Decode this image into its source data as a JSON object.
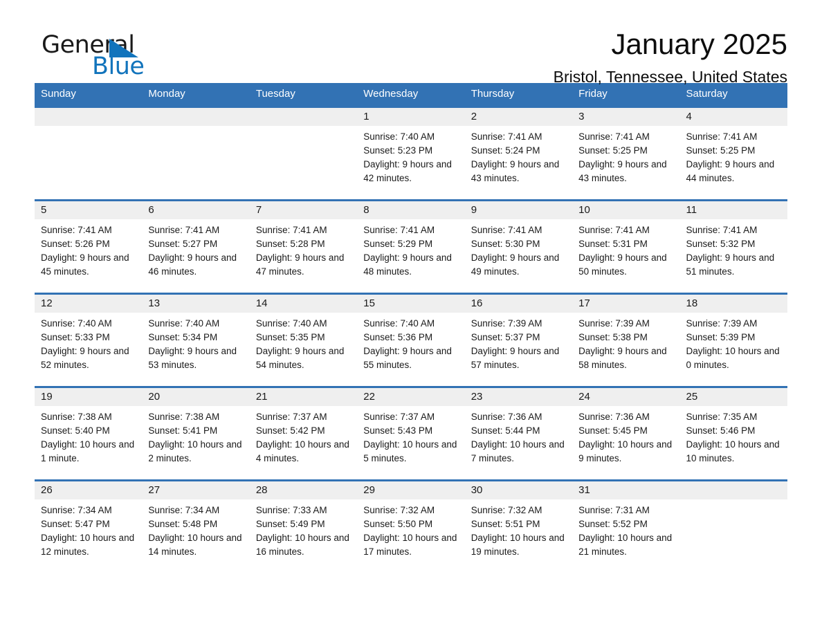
{
  "logo": {
    "word_one": "General",
    "word_two": "Blue",
    "triangle_icon": "triangle-icon",
    "accent_color": "#1274bc"
  },
  "header": {
    "month_title": "January 2025",
    "location": "Bristol, Tennessee, United States"
  },
  "calendar": {
    "header_color": "#3272b4",
    "daynum_band_color": "#efefef",
    "weekday_headers": [
      "Sunday",
      "Monday",
      "Tuesday",
      "Wednesday",
      "Thursday",
      "Friday",
      "Saturday"
    ],
    "weeks": [
      [
        {
          "day": "",
          "sunrise": "",
          "sunset": "",
          "daylight": "",
          "empty": true
        },
        {
          "day": "",
          "sunrise": "",
          "sunset": "",
          "daylight": "",
          "empty": true
        },
        {
          "day": "",
          "sunrise": "",
          "sunset": "",
          "daylight": "",
          "empty": true
        },
        {
          "day": "1",
          "sunrise": "Sunrise: 7:40 AM",
          "sunset": "Sunset: 5:23 PM",
          "daylight": "Daylight: 9 hours and 42 minutes.",
          "empty": false
        },
        {
          "day": "2",
          "sunrise": "Sunrise: 7:41 AM",
          "sunset": "Sunset: 5:24 PM",
          "daylight": "Daylight: 9 hours and 43 minutes.",
          "empty": false
        },
        {
          "day": "3",
          "sunrise": "Sunrise: 7:41 AM",
          "sunset": "Sunset: 5:25 PM",
          "daylight": "Daylight: 9 hours and 43 minutes.",
          "empty": false
        },
        {
          "day": "4",
          "sunrise": "Sunrise: 7:41 AM",
          "sunset": "Sunset: 5:25 PM",
          "daylight": "Daylight: 9 hours and 44 minutes.",
          "empty": false
        }
      ],
      [
        {
          "day": "5",
          "sunrise": "Sunrise: 7:41 AM",
          "sunset": "Sunset: 5:26 PM",
          "daylight": "Daylight: 9 hours and 45 minutes.",
          "empty": false
        },
        {
          "day": "6",
          "sunrise": "Sunrise: 7:41 AM",
          "sunset": "Sunset: 5:27 PM",
          "daylight": "Daylight: 9 hours and 46 minutes.",
          "empty": false
        },
        {
          "day": "7",
          "sunrise": "Sunrise: 7:41 AM",
          "sunset": "Sunset: 5:28 PM",
          "daylight": "Daylight: 9 hours and 47 minutes.",
          "empty": false
        },
        {
          "day": "8",
          "sunrise": "Sunrise: 7:41 AM",
          "sunset": "Sunset: 5:29 PM",
          "daylight": "Daylight: 9 hours and 48 minutes.",
          "empty": false
        },
        {
          "day": "9",
          "sunrise": "Sunrise: 7:41 AM",
          "sunset": "Sunset: 5:30 PM",
          "daylight": "Daylight: 9 hours and 49 minutes.",
          "empty": false
        },
        {
          "day": "10",
          "sunrise": "Sunrise: 7:41 AM",
          "sunset": "Sunset: 5:31 PM",
          "daylight": "Daylight: 9 hours and 50 minutes.",
          "empty": false
        },
        {
          "day": "11",
          "sunrise": "Sunrise: 7:41 AM",
          "sunset": "Sunset: 5:32 PM",
          "daylight": "Daylight: 9 hours and 51 minutes.",
          "empty": false
        }
      ],
      [
        {
          "day": "12",
          "sunrise": "Sunrise: 7:40 AM",
          "sunset": "Sunset: 5:33 PM",
          "daylight": "Daylight: 9 hours and 52 minutes.",
          "empty": false
        },
        {
          "day": "13",
          "sunrise": "Sunrise: 7:40 AM",
          "sunset": "Sunset: 5:34 PM",
          "daylight": "Daylight: 9 hours and 53 minutes.",
          "empty": false
        },
        {
          "day": "14",
          "sunrise": "Sunrise: 7:40 AM",
          "sunset": "Sunset: 5:35 PM",
          "daylight": "Daylight: 9 hours and 54 minutes.",
          "empty": false
        },
        {
          "day": "15",
          "sunrise": "Sunrise: 7:40 AM",
          "sunset": "Sunset: 5:36 PM",
          "daylight": "Daylight: 9 hours and 55 minutes.",
          "empty": false
        },
        {
          "day": "16",
          "sunrise": "Sunrise: 7:39 AM",
          "sunset": "Sunset: 5:37 PM",
          "daylight": "Daylight: 9 hours and 57 minutes.",
          "empty": false
        },
        {
          "day": "17",
          "sunrise": "Sunrise: 7:39 AM",
          "sunset": "Sunset: 5:38 PM",
          "daylight": "Daylight: 9 hours and 58 minutes.",
          "empty": false
        },
        {
          "day": "18",
          "sunrise": "Sunrise: 7:39 AM",
          "sunset": "Sunset: 5:39 PM",
          "daylight": "Daylight: 10 hours and 0 minutes.",
          "empty": false
        }
      ],
      [
        {
          "day": "19",
          "sunrise": "Sunrise: 7:38 AM",
          "sunset": "Sunset: 5:40 PM",
          "daylight": "Daylight: 10 hours and 1 minute.",
          "empty": false
        },
        {
          "day": "20",
          "sunrise": "Sunrise: 7:38 AM",
          "sunset": "Sunset: 5:41 PM",
          "daylight": "Daylight: 10 hours and 2 minutes.",
          "empty": false
        },
        {
          "day": "21",
          "sunrise": "Sunrise: 7:37 AM",
          "sunset": "Sunset: 5:42 PM",
          "daylight": "Daylight: 10 hours and 4 minutes.",
          "empty": false
        },
        {
          "day": "22",
          "sunrise": "Sunrise: 7:37 AM",
          "sunset": "Sunset: 5:43 PM",
          "daylight": "Daylight: 10 hours and 5 minutes.",
          "empty": false
        },
        {
          "day": "23",
          "sunrise": "Sunrise: 7:36 AM",
          "sunset": "Sunset: 5:44 PM",
          "daylight": "Daylight: 10 hours and 7 minutes.",
          "empty": false
        },
        {
          "day": "24",
          "sunrise": "Sunrise: 7:36 AM",
          "sunset": "Sunset: 5:45 PM",
          "daylight": "Daylight: 10 hours and 9 minutes.",
          "empty": false
        },
        {
          "day": "25",
          "sunrise": "Sunrise: 7:35 AM",
          "sunset": "Sunset: 5:46 PM",
          "daylight": "Daylight: 10 hours and 10 minutes.",
          "empty": false
        }
      ],
      [
        {
          "day": "26",
          "sunrise": "Sunrise: 7:34 AM",
          "sunset": "Sunset: 5:47 PM",
          "daylight": "Daylight: 10 hours and 12 minutes.",
          "empty": false
        },
        {
          "day": "27",
          "sunrise": "Sunrise: 7:34 AM",
          "sunset": "Sunset: 5:48 PM",
          "daylight": "Daylight: 10 hours and 14 minutes.",
          "empty": false
        },
        {
          "day": "28",
          "sunrise": "Sunrise: 7:33 AM",
          "sunset": "Sunset: 5:49 PM",
          "daylight": "Daylight: 10 hours and 16 minutes.",
          "empty": false
        },
        {
          "day": "29",
          "sunrise": "Sunrise: 7:32 AM",
          "sunset": "Sunset: 5:50 PM",
          "daylight": "Daylight: 10 hours and 17 minutes.",
          "empty": false
        },
        {
          "day": "30",
          "sunrise": "Sunrise: 7:32 AM",
          "sunset": "Sunset: 5:51 PM",
          "daylight": "Daylight: 10 hours and 19 minutes.",
          "empty": false
        },
        {
          "day": "31",
          "sunrise": "Sunrise: 7:31 AM",
          "sunset": "Sunset: 5:52 PM",
          "daylight": "Daylight: 10 hours and 21 minutes.",
          "empty": false
        },
        {
          "day": "",
          "sunrise": "",
          "sunset": "",
          "daylight": "",
          "empty": true
        }
      ]
    ]
  }
}
